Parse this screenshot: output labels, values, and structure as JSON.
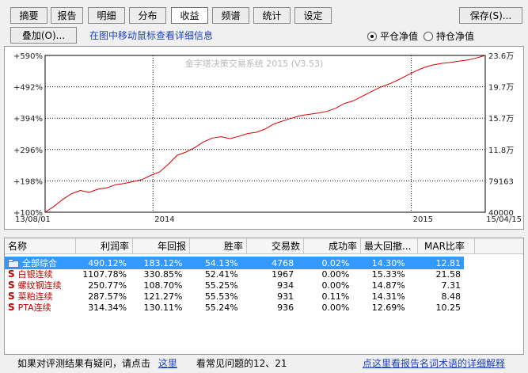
{
  "tabs": [
    "摘要",
    "报告",
    "明细",
    "分布",
    "收益",
    "频谱",
    "统计",
    "设定"
  ],
  "active_tab": 4,
  "save_button": "保存(S)...",
  "overlay_button": "叠加(O)...",
  "hint_text": "在图中移动鼠标查看详细信息",
  "radio": {
    "option1": "平仓净值",
    "option2": "持仓净值",
    "selected": "option1"
  },
  "chart": {
    "watermark": "金字塔决策交易系统 2015 (V3.53)",
    "start_date": "13/08/01",
    "end_date": "15/04/15",
    "year_labels": [
      "2014",
      "2015"
    ]
  },
  "chart_data": {
    "type": "line",
    "title": "",
    "left_axis_labels": [
      "+590%",
      "+492%",
      "+394%",
      "+296%",
      "+198%",
      "+100%"
    ],
    "right_axis_labels": [
      "23.6万",
      "19.7万",
      "15.7万",
      "11.8万",
      "79163",
      "40000"
    ],
    "ylim_left": [
      100,
      590
    ],
    "ylim_right": [
      40000,
      236000
    ],
    "x_labels": [
      "13/08/01",
      "2014",
      "2015",
      "15/04/15"
    ],
    "series": [
      {
        "color": "#d40000",
        "x": [
          0,
          2,
          4,
          6,
          8,
          10,
          12,
          14,
          16,
          18,
          20,
          22,
          24,
          26,
          28,
          30,
          32,
          34,
          36,
          38,
          40,
          42,
          44,
          46,
          48,
          50,
          52,
          54,
          56,
          58,
          60,
          62,
          64,
          66,
          68,
          70,
          72,
          74,
          76,
          78,
          80,
          82,
          84,
          86,
          88,
          90,
          92,
          94,
          96,
          98,
          100
        ],
        "y": [
          100,
          118,
          140,
          158,
          168,
          162,
          172,
          176,
          186,
          190,
          196,
          202,
          215,
          226,
          250,
          278,
          288,
          302,
          320,
          332,
          336,
          330,
          337,
          346,
          350,
          360,
          376,
          385,
          394,
          402,
          406,
          410,
          415,
          425,
          440,
          448,
          462,
          476,
          490,
          500,
          512,
          526,
          540,
          552,
          560,
          565,
          568,
          572,
          576,
          582,
          590
        ]
      }
    ]
  },
  "table": {
    "headers": [
      "名称",
      "利润率",
      "年回报",
      "胜率",
      "交易数",
      "成功率",
      "最大回撤...",
      "MAR比率"
    ],
    "rows": [
      {
        "name": "全部综合",
        "profit": "490.12%",
        "annual": "183.12%",
        "win": "54.13%",
        "trades": "4768",
        "success": "0.02%",
        "drawdown": "14.30%",
        "mar": "12.81",
        "type": "folder"
      },
      {
        "name": "白银连续",
        "profit": "1107.78%",
        "annual": "330.85%",
        "win": "52.41%",
        "trades": "1967",
        "success": "0.00%",
        "drawdown": "15.33%",
        "mar": "21.58",
        "type": "s"
      },
      {
        "name": "螺纹钢连续",
        "profit": "250.77%",
        "annual": "108.70%",
        "win": "55.25%",
        "trades": "934",
        "success": "0.00%",
        "drawdown": "14.87%",
        "mar": "7.31",
        "type": "s"
      },
      {
        "name": "菜粕连续",
        "profit": "287.57%",
        "annual": "121.27%",
        "win": "55.53%",
        "trades": "931",
        "success": "0.11%",
        "drawdown": "14.31%",
        "mar": "8.48",
        "type": "s"
      },
      {
        "name": "PTA连续",
        "profit": "314.34%",
        "annual": "130.11%",
        "win": "55.24%",
        "trades": "936",
        "success": "0.00%",
        "drawdown": "12.69%",
        "mar": "10.25",
        "type": "s"
      }
    ]
  },
  "footer": {
    "question_text": "如果对评测结果有疑问，请点击",
    "here_link": "这里",
    "faq_text": "看常见问题的12、21",
    "glossary_link": "点这里看报告名词术语的详细解释"
  },
  "colors": {
    "line": "#d40000",
    "selected_row": "#3399ff",
    "link": "#1a3fbf",
    "name_text": "#c00000"
  }
}
